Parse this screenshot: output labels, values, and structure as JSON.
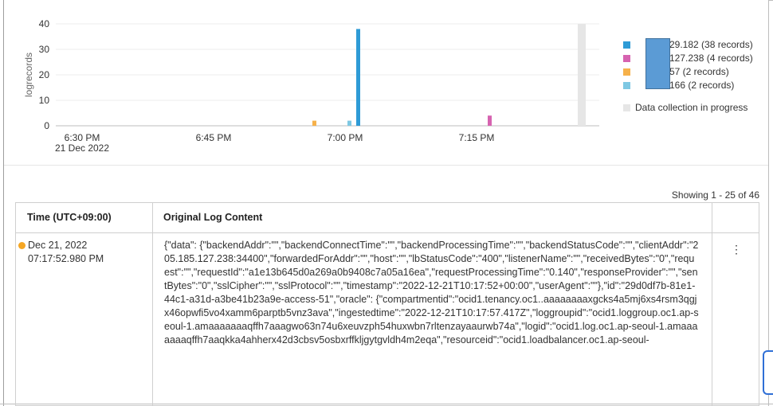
{
  "chart_data": {
    "type": "bar",
    "ylabel": "logrecords",
    "ylim": [
      0,
      40
    ],
    "yticks": [
      0,
      10,
      20,
      30,
      40
    ],
    "xticks": [
      {
        "label": "6:30 PM",
        "sub": "21 Dec 2022",
        "t": 0
      },
      {
        "label": "6:45 PM",
        "sub": "",
        "t": 15
      },
      {
        "label": "7:00 PM",
        "sub": "",
        "t": 30
      },
      {
        "label": "7:15 PM",
        "sub": "",
        "t": 45
      }
    ],
    "x_unit": "minutes after 6:30 PM",
    "xlim": [
      -3,
      59
    ],
    "grid": true,
    "series": [
      {
        "name": "29.182 (38 records)",
        "color": "#2e9bd6",
        "points": [
          {
            "t": 31.5,
            "value": 38
          }
        ]
      },
      {
        "name": "127.238 (4 records)",
        "color": "#d663b0",
        "points": [
          {
            "t": 46.5,
            "value": 4
          }
        ]
      },
      {
        "name": "57 (2 records)",
        "color": "#f6b14a",
        "points": [
          {
            "t": 26.5,
            "value": 2
          }
        ]
      },
      {
        "name": "166 (2 records)",
        "color": "#7ec8e3",
        "points": [
          {
            "t": 30.5,
            "value": 2
          }
        ]
      }
    ],
    "progress_band": {
      "t": 57,
      "value": 40,
      "color": "#e6e6e6"
    },
    "legend": {
      "placement": "right",
      "progress_label": "Data collection in progress"
    }
  },
  "results": {
    "showing": "Showing 1 - 25 of 46",
    "columns": [
      "Time (UTC+09:00)",
      "Original Log Content"
    ],
    "rows": [
      {
        "date": "Dec 21, 2022",
        "time": "07:17:52.980 PM",
        "dot_color": "#f5a623",
        "content": "{\"data\": {\"backendAddr\":\"\",\"backendConnectTime\":\"\",\"backendProcessingTime\":\"\",\"backendStatusCode\":\"\",\"clientAddr\":\"205.185.127.238:34400\",\"forwardedForAddr\":\"\",\"host\":\"\",\"lbStatusCode\":\"400\",\"listenerName\":\"\",\"receivedBytes\":\"0\",\"request\":\"\",\"requestId\":\"a1e13b645d0a269a0b9408c7a05a16ea\",\"requestProcessingTime\":\"0.140\",\"responseProvider\":\"\",\"sentBytes\":\"0\",\"sslCipher\":\"\",\"sslProtocol\":\"\",\"timestamp\":\"2022-12-21T10:17:52+00:00\",\"userAgent\":\"\"},\"id\":\"29d0df7b-81e1-44c1-a31d-a3be41b23a9e-access-51\",\"oracle\": {\"compartmentid\":\"ocid1.tenancy.oc1..aaaaaaaaxgcks4a5mj6xs4rsm3qgjx46opwfi5vo4xamm6parptb5vnz3ava\",\"ingestedtime\":\"2022-12-21T10:17:57.417Z\",\"loggroupid\":\"ocid1.loggroup.oc1.ap-seoul-1.amaaaaaaaqffh7aaagwo63n74u6xeuvzph54huxwbn7rltenzayaaurwb74a\",\"logid\":\"ocid1.log.oc1.ap-seoul-1.amaaaaaaaqffh7aaqkka4ahherx42d3cbsv5osbxrffkljgytgvldh4m2eqa\",\"resourceid\":\"ocid1.loadbalancer.oc1.ap-seoul-"
      }
    ],
    "row_menu_icon": "⋮"
  }
}
